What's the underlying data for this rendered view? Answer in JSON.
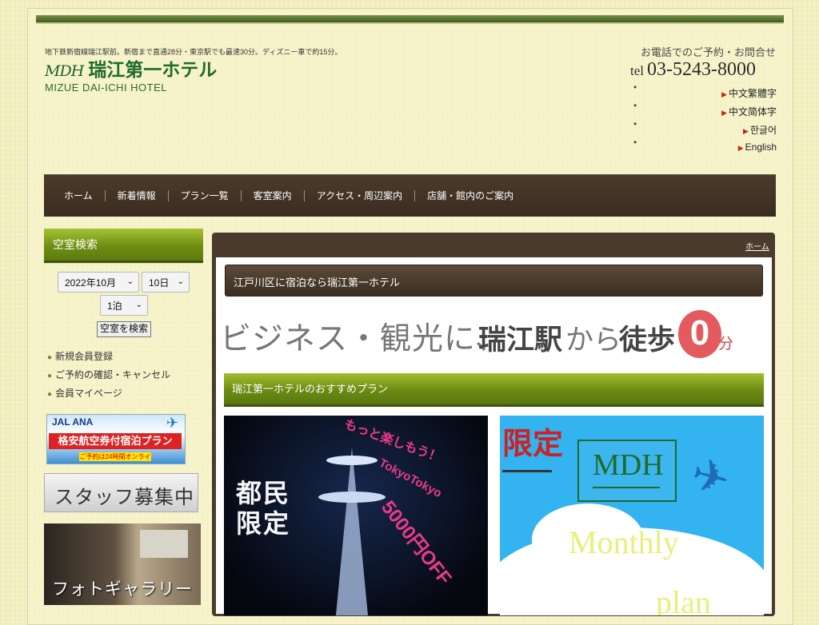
{
  "header": {
    "tagline": "地下鉄新宿線瑞江駅前。新宿まで直通28分・東京駅でも最速30分。ディズニー車で約15分。",
    "logo_mark": "MDH",
    "logo_name": "瑞江第一ホテル",
    "logo_en": "MIZUE DAI-ICHI HOTEL",
    "contact_label": "お電話でのご予約・お問合せ",
    "tel_prefix": "tel",
    "tel_number": "03-5243-8000",
    "languages": [
      {
        "label": "中文繁體字"
      },
      {
        "label": "中文简体字"
      },
      {
        "label": "한글어"
      },
      {
        "label": "English"
      }
    ]
  },
  "nav": {
    "items": [
      "ホーム",
      "新着情報",
      "プラン一覧",
      "客室案内",
      "アクセス・周辺案内",
      "店舗・館内のご案内"
    ]
  },
  "sidebar": {
    "title": "空室検索",
    "year_month": "2022年10月",
    "day": "10日",
    "nights": "1泊",
    "search_button": "空室を検索",
    "links": [
      "新規会員登録",
      "ご予約の確認・キャンセル",
      "会員マイページ"
    ],
    "banner_airline": {
      "logos": "JAL ANA",
      "main": "格安航空券付宿泊プラン",
      "sub": "ご予約は24時間オンライン!"
    },
    "banner_staff": "スタッフ募集中",
    "banner_photo": "フォトギャラリー"
  },
  "main": {
    "breadcrumb": "ホーム",
    "section1_title": "江戸川区に宿泊なら瑞江第一ホテル",
    "hero": {
      "part1": "ビジネス・観光に、",
      "part2": "瑞江駅",
      "part3": "から",
      "part4": "徒歩",
      "zero": "0",
      "unit": "分"
    },
    "section2_title": "瑞江第一ホテルのおすすめプラン",
    "plan_a": {
      "kanji_line1": "都民",
      "kanji_line2": "限定",
      "motto": "もっと楽しもう！",
      "tokyo": "TokyoTokyo",
      "off": "5000円OFF"
    },
    "plan_b": {
      "limited": "限定",
      "mdh": "MDH",
      "monthly": "Monthly",
      "plan": "plan"
    }
  },
  "colors": {
    "nav_bg": "#3f3124",
    "green_header": "#7a9818",
    "accent_red": "#c0281a"
  }
}
